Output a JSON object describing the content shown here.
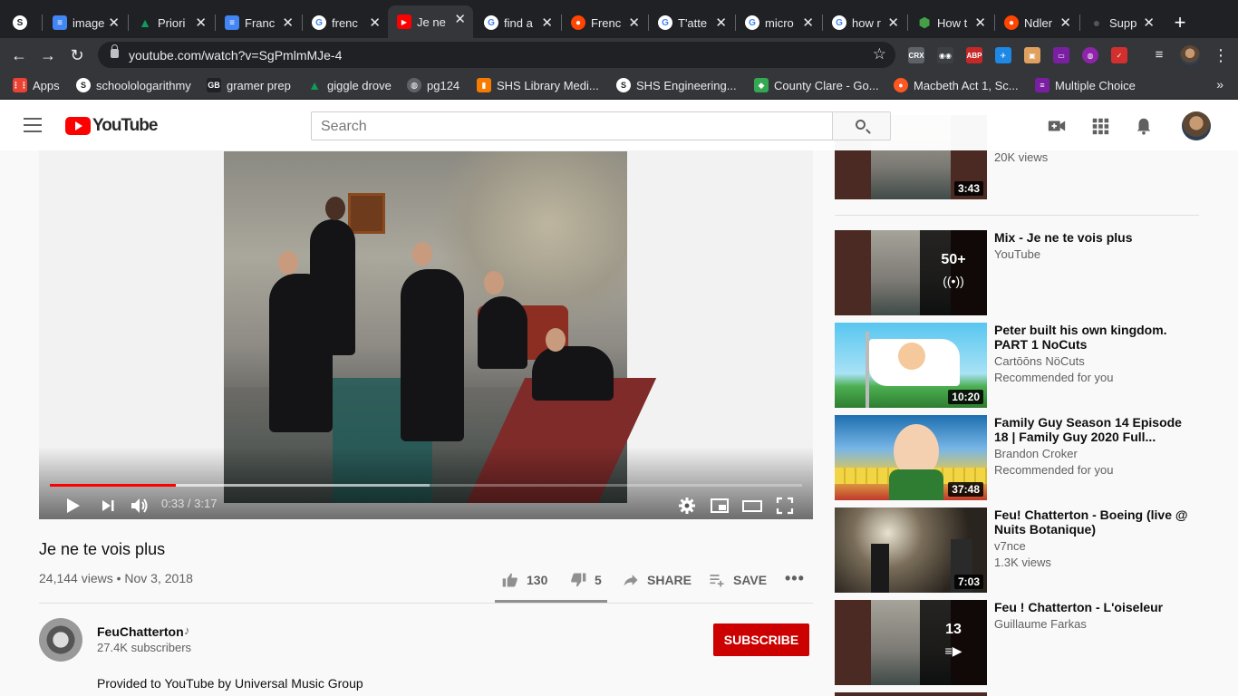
{
  "browser": {
    "tabs": [
      {
        "title": "image",
        "fav_color": "#4285f4",
        "fav": "≡"
      },
      {
        "title": "Priori",
        "fav_color": "#0f9d58",
        "fav": "▲"
      },
      {
        "title": "Franc",
        "fav_color": "#4285f4",
        "fav": "≡"
      },
      {
        "title": "frenc",
        "fav_color": "#ffffff",
        "fav": "G"
      },
      {
        "title": "Je ne",
        "fav_color": "#ff0000",
        "fav": "▶",
        "active": true
      },
      {
        "title": "find a",
        "fav_color": "#ffffff",
        "fav": "G"
      },
      {
        "title": "Frenc",
        "fav_color": "#ff4500",
        "fav": "●"
      },
      {
        "title": "T'atte",
        "fav_color": "#ffffff",
        "fav": "G"
      },
      {
        "title": "micro",
        "fav_color": "#ffffff",
        "fav": "G"
      },
      {
        "title": "how r",
        "fav_color": "#ffffff",
        "fav": "G"
      },
      {
        "title": "How t",
        "fav_color": "#2e7d32",
        "fav": "⬢"
      },
      {
        "title": "Ndler",
        "fav_color": "#ff4500",
        "fav": "●"
      },
      {
        "title": "Supp",
        "fav_color": "#333333",
        "fav": "●"
      }
    ],
    "url": "youtube.com/watch?v=SgPmlmMJe-4",
    "bookmarks": [
      {
        "label": "Apps",
        "color": "#ea4335",
        "icon": "grid-icon"
      },
      {
        "label": "schoolologarithmy",
        "color": "#202124",
        "icon": "s-circle-icon"
      },
      {
        "label": "gramer prep",
        "color": "#202124",
        "icon": "gb-icon"
      },
      {
        "label": "giggle drove",
        "color": "#0f9d58",
        "icon": "drive-icon"
      },
      {
        "label": "pg124",
        "color": "#5f6368",
        "icon": "globe-icon"
      },
      {
        "label": "SHS Library Medi...",
        "color": "#f57c00",
        "icon": "bookmark-icon"
      },
      {
        "label": "SHS Engineering...",
        "color": "#202124",
        "icon": "s-circle-icon"
      },
      {
        "label": "County Clare - Go...",
        "color": "#34a853",
        "icon": "maps-icon"
      },
      {
        "label": "Macbeth Act 1, Sc...",
        "color": "#ff5722",
        "icon": "bookmark-icon"
      },
      {
        "label": "Multiple Choice",
        "color": "#7b1fa2",
        "icon": "forms-icon"
      }
    ],
    "extensions": [
      {
        "name": "crx-icon",
        "label": "CRX",
        "color": "#5f6368"
      },
      {
        "name": "owl-icon",
        "label": "◉◉",
        "color": "#3c4043"
      },
      {
        "name": "adblock-icon",
        "label": "ABP",
        "color": "#c62828"
      },
      {
        "name": "bird-icon",
        "label": "✈",
        "color": "#1e88e5"
      },
      {
        "name": "box-icon",
        "label": "▣",
        "color": "#e0a060"
      },
      {
        "name": "screen-icon",
        "label": "▭",
        "color": "#7b1fa2"
      },
      {
        "name": "dot-icon",
        "label": "",
        "color": "#35363a"
      },
      {
        "name": "color-wheel-icon",
        "label": "◍",
        "color": "#8e24aa"
      },
      {
        "name": "check-icon",
        "label": "✓",
        "color": "#d32f2f"
      }
    ]
  },
  "youtube": {
    "logo_text": "YouTube",
    "search_placeholder": "Search",
    "player": {
      "time": "0:33 / 3:17",
      "played_fraction": 0.168,
      "buffered_fraction": 0.505
    },
    "video": {
      "title": "Je ne te vois plus",
      "meta": "24,144 views • Nov 3, 2018",
      "likes": "130",
      "dislikes": "5",
      "share": "SHARE",
      "save": "SAVE",
      "like_ratio": 0.963
    },
    "channel": {
      "name": "FeuChatterton",
      "note": "♪",
      "subscribers": "27.4K subscribers",
      "subscribe": "SUBSCRIBE",
      "description": "Provided to YouTube by Universal Music Group"
    },
    "sidebar": {
      "first_partial": {
        "views": "20K views",
        "duration": "3:43"
      },
      "items": [
        {
          "title": "Mix - Je ne te vois plus",
          "line1": "YouTube",
          "line2": "",
          "overlay_num": "50+",
          "overlay_sym": "((•))"
        },
        {
          "title": "Peter built his own kingdom. PART 1 NoCuts",
          "line1": "Cartōōns NöCuts",
          "line2": "Recommended for you",
          "duration": "10:20"
        },
        {
          "title": "Family Guy Season 14 Episode 18 | Family Guy 2020 Full...",
          "line1": "Brandon Croker",
          "line2": "Recommended for you",
          "duration": "37:48"
        },
        {
          "title": "Feu! Chatterton - Boeing (live @ Nuits Botanique)",
          "line1": "v7nce",
          "line2": "1.3K views",
          "duration": "7:03"
        },
        {
          "title": "Feu ! Chatterton - L'oiseleur",
          "line1": "Guillaume Farkas",
          "line2": "",
          "overlay_num": "13",
          "overlay_sym": "≡▶"
        }
      ]
    }
  }
}
